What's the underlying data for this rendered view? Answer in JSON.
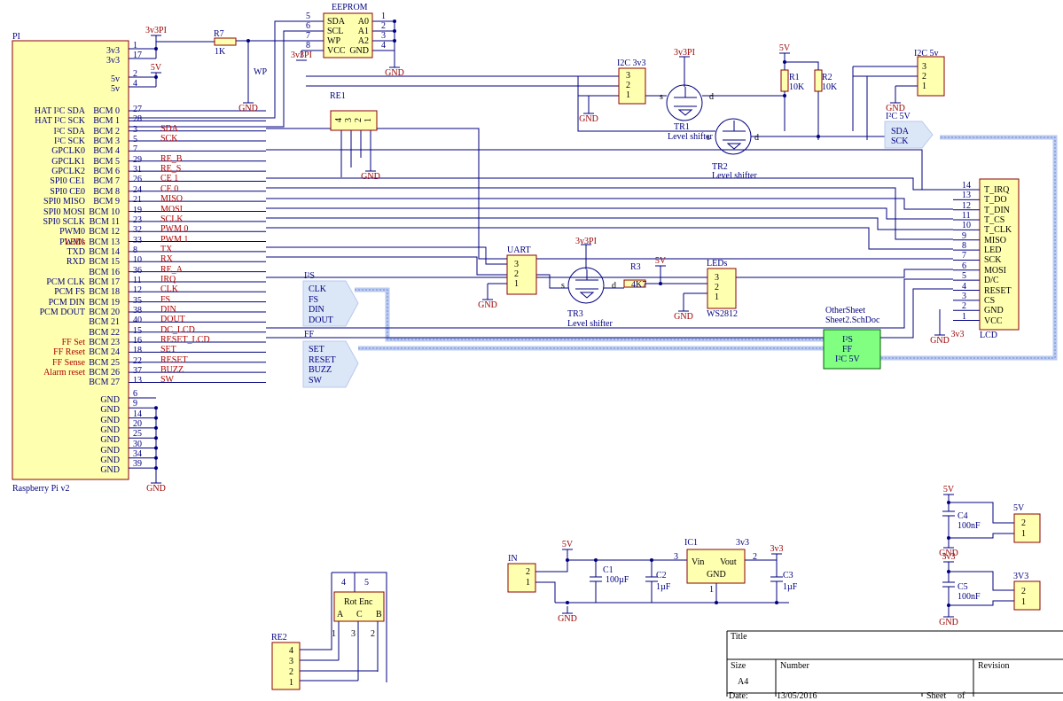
{
  "pi": {
    "title": "PI",
    "footer": "Raspberry Pi v2",
    "left_labels": [
      "HAT I²C SDA",
      "HAT I²C SCK",
      "I²C SDA",
      "I²C SCK",
      "GPCLK0",
      "GPCLK1",
      "GPCLK2",
      "SPI0 CE1",
      "SPI0 CE0",
      "SPI0 MISO",
      "SPI0 MOSI",
      "SPI0 SCLK",
      "PWM0",
      "PWM1",
      "TXD",
      "RXD",
      "",
      "PCM CLK",
      "PCM FS",
      "PCM DIN",
      "PCM DOUT",
      "",
      "",
      "FF Set",
      "FF Reset",
      "FF Sense",
      "Alarm reset"
    ],
    "leds_label": "LEDs",
    "bcm": [
      "BCM 0",
      "BCM 1",
      "BCM 2",
      "BCM 3",
      "BCM 4",
      "BCM 5",
      "BCM 6",
      "BCM 7",
      "BCM 8",
      "BCM 9",
      "BCM 10",
      "BCM 11",
      "BCM 12",
      "BCM 13",
      "BCM 14",
      "BCM 15",
      "BCM 16",
      "BCM 17",
      "BCM 18",
      "BCM 19",
      "BCM 20",
      "BCM 21",
      "BCM 22",
      "BCM 23",
      "BCM 24",
      "BCM 25",
      "BCM 26",
      "BCM 27"
    ],
    "bcm_pins": [
      "27",
      "28",
      "3",
      "5",
      "7",
      "29",
      "31",
      "26",
      "24",
      "21",
      "19",
      "23",
      "32",
      "33",
      "8",
      "10",
      "36",
      "11",
      "12",
      "35",
      "38",
      "40",
      "15",
      "16",
      "18",
      "22",
      "37",
      "13"
    ],
    "nets": [
      "",
      "",
      "SDA",
      "SCK",
      "",
      "RE_B",
      "RE_S",
      "CE 1",
      "CE 0",
      "MISO",
      "MOSI",
      "SCLK",
      "PWM 0",
      "PWM 1",
      "TX",
      "RX",
      "RE_A",
      "IRQ",
      "CLK",
      "FS",
      "DIN",
      "DOUT",
      "DC_LCD",
      "RESET_LCD",
      "SET",
      "RESET",
      "BUZZ",
      "SW"
    ],
    "power": [
      {
        "name": "3v3",
        "pin": "1"
      },
      {
        "name": "3v3",
        "pin": "17"
      },
      {
        "name": "5v",
        "pin": "2"
      },
      {
        "name": "5v",
        "pin": "4"
      }
    ],
    "gnd_pins": [
      "6",
      "9",
      "14",
      "20",
      "25",
      "30",
      "34",
      "39"
    ],
    "gnd_label": "GND"
  },
  "eeprom": {
    "title": "EEPROM",
    "left": [
      "SDA",
      "SCL",
      "WP",
      "VCC"
    ],
    "right": [
      "A0",
      "A1",
      "A2",
      "GND"
    ],
    "lpins": [
      "5",
      "6",
      "7",
      "8"
    ],
    "rpins": [
      "1",
      "2",
      "3",
      "4"
    ]
  },
  "r7": {
    "name": "R7",
    "value": "1K"
  },
  "wp": "WP",
  "rail_3v3pi": "3v3PI",
  "rail_5v": "5V",
  "rail_3v3": "3v3",
  "gnd": "GND",
  "re1": {
    "title": "RE1",
    "pins": [
      "4",
      "3",
      "2",
      "1"
    ]
  },
  "i2c33": {
    "title": "I2C 3v3",
    "pins": [
      "3",
      "2",
      "1"
    ]
  },
  "i2c5v": {
    "title": "I2C 5v",
    "pins": [
      "3",
      "2",
      "1"
    ]
  },
  "tr1": {
    "name": "TR1",
    "desc": "Level shifter",
    "s": "s",
    "d": "d"
  },
  "tr2": {
    "name": "TR2",
    "desc": "Level shifter",
    "s": "s",
    "d": "d"
  },
  "tr3": {
    "name": "TR3",
    "desc": "Level shifter",
    "s": "s",
    "d": "d"
  },
  "r1": {
    "name": "R1",
    "value": "10K"
  },
  "r2": {
    "name": "R2",
    "value": "10K"
  },
  "r3": {
    "name": "R3",
    "value": "4K7"
  },
  "i2c5v_port": {
    "title": "I²C 5V",
    "pins": [
      "SDA",
      "SCK"
    ]
  },
  "uart": {
    "title": "UART",
    "pins": [
      "3",
      "2",
      "1"
    ]
  },
  "leds": {
    "title": "LEDs",
    "sub": "WS2812",
    "pins": [
      "3",
      "2",
      "1"
    ]
  },
  "i2s": {
    "title": "I²S",
    "pins": [
      "CLK",
      "FS",
      "DIN",
      "DOUT"
    ]
  },
  "ff": {
    "title": "FF",
    "pins": [
      "SET",
      "RESET",
      "BUZZ",
      "SW"
    ]
  },
  "sheet": {
    "title": "OtherSheet",
    "file": "Sheet2.SchDoc",
    "ports": [
      "I²S",
      "FF",
      "I²C 5V"
    ]
  },
  "lcd": {
    "title": "LCD",
    "pins": [
      "T_IRQ",
      "T_DO",
      "T_DIN",
      "T_CS",
      "T_CLK",
      "MISO",
      "LED",
      "SCK",
      "MOSI",
      "D/C",
      "RESET",
      "CS",
      "GND",
      "VCC"
    ],
    "nums": [
      "14",
      "13",
      "12",
      "11",
      "10",
      "9",
      "8",
      "7",
      "6",
      "5",
      "4",
      "3",
      "2",
      "1"
    ]
  },
  "power_in": {
    "title": "IN",
    "pins": [
      "2",
      "1"
    ]
  },
  "ic1": {
    "name": "IC1",
    "rail": "3v3",
    "vin": "Vin",
    "vout": "Vout",
    "gnd": "GND",
    "pin_in": "3",
    "pin_out": "2",
    "pin_gnd": "1"
  },
  "c1": {
    "name": "C1",
    "value": "100µF"
  },
  "c2": {
    "name": "C2",
    "value": "1µF"
  },
  "c3": {
    "name": "C3",
    "value": "1µF"
  },
  "c4": {
    "name": "C4",
    "value": "100nF"
  },
  "c5": {
    "name": "C5",
    "value": "100nF"
  },
  "hdr5v": {
    "title": "5V",
    "pins": [
      "2",
      "1"
    ]
  },
  "hdr3v3": {
    "title": "3V3",
    "pins": [
      "2",
      "1"
    ]
  },
  "rotenc": {
    "title": "Rot Enc",
    "pins": [
      "A",
      "C",
      "B"
    ],
    "top": [
      "4",
      "5"
    ],
    "bot": [
      "1",
      "3",
      "2"
    ]
  },
  "re2": {
    "title": "RE2",
    "pins": [
      "4",
      "3",
      "2",
      "1"
    ]
  },
  "titleblock": {
    "title": "Title",
    "size": "Size",
    "size_val": "A4",
    "number": "Number",
    "revision": "Revision",
    "date": "Date:",
    "date_val": "13/05/2016",
    "sheet": "Sheet",
    "of": "of"
  },
  "colors": {
    "wire": "#00007f",
    "body": "#ffffb0",
    "bodyline": "#8b0000",
    "bus": "#b9c9ef",
    "green": "#80ff80"
  }
}
